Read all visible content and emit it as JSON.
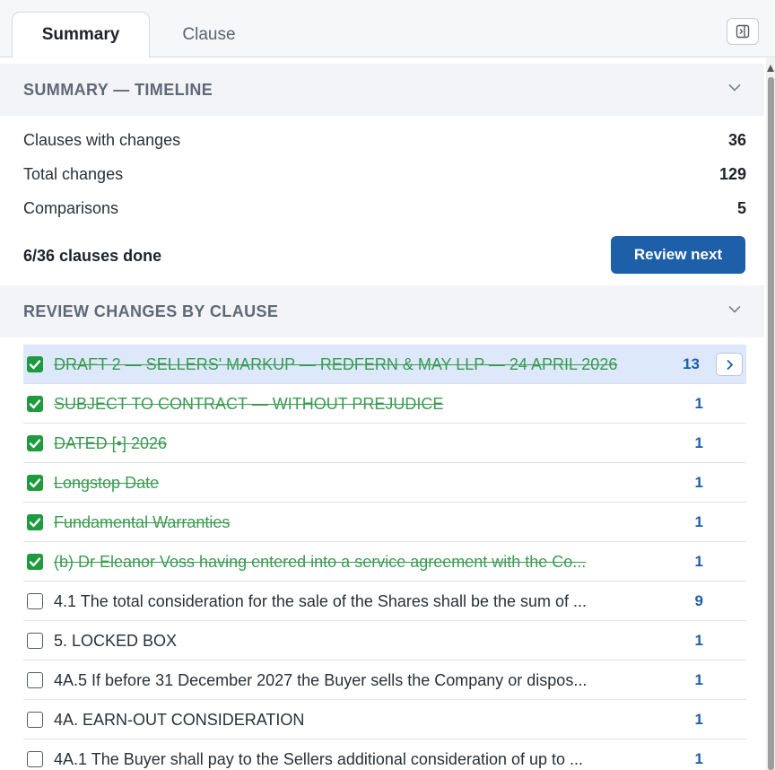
{
  "tabs": [
    {
      "label": "Summary",
      "active": true
    },
    {
      "label": "Clause",
      "active": false
    }
  ],
  "summary": {
    "title": "SUMMARY — TIMELINE",
    "stats": [
      {
        "label": "Clauses with changes",
        "value": "36"
      },
      {
        "label": "Total changes",
        "value": "129"
      },
      {
        "label": "Comparisons",
        "value": "5"
      }
    ],
    "progress": "6/36 clauses done",
    "review_next_label": "Review next"
  },
  "review": {
    "title": "REVIEW CHANGES BY CLAUSE",
    "rows": [
      {
        "text": "DRAFT 2 — SELLERS' MARKUP — REDFERN & MAY LLP — 24 APRIL 2026",
        "count": "13",
        "done": true,
        "selected": true
      },
      {
        "text": "SUBJECT TO CONTRACT — WITHOUT PREJUDICE",
        "count": "1",
        "done": true,
        "selected": false
      },
      {
        "text": "DATED [•] 2026",
        "count": "1",
        "done": true,
        "selected": false
      },
      {
        "text": "Longstop Date",
        "count": "1",
        "done": true,
        "selected": false
      },
      {
        "text": "Fundamental Warranties",
        "count": "1",
        "done": true,
        "selected": false
      },
      {
        "text": "(b) Dr Eleanor Voss having entered into a service agreement with the Co...",
        "count": "1",
        "done": true,
        "selected": false
      },
      {
        "text": "4.1 The total consideration for the sale of the Shares shall be the sum of ...",
        "count": "9",
        "done": false,
        "selected": false
      },
      {
        "text": "5. LOCKED BOX",
        "count": "1",
        "done": false,
        "selected": false
      },
      {
        "text": "4A.5 If before 31 December 2027 the Buyer sells the Company or dispos...",
        "count": "1",
        "done": false,
        "selected": false
      },
      {
        "text": "4A. EARN-OUT CONSIDERATION",
        "count": "1",
        "done": false,
        "selected": false
      },
      {
        "text": "4A.1 The Buyer shall pay to the Sellers additional consideration of up to ...",
        "count": "1",
        "done": false,
        "selected": false
      }
    ]
  },
  "colors": {
    "accent": "#1d5fa8",
    "done_green": "#1e9a3f",
    "selected_row": "#dde9fb",
    "section_header_bg": "#f2f4f7"
  },
  "icons": {
    "collapse_panel": "panel-collapse-icon",
    "section_toggle": "chevron-down-icon",
    "row_open": "chevron-right-icon",
    "checkbox_done": "checkmark-icon"
  }
}
